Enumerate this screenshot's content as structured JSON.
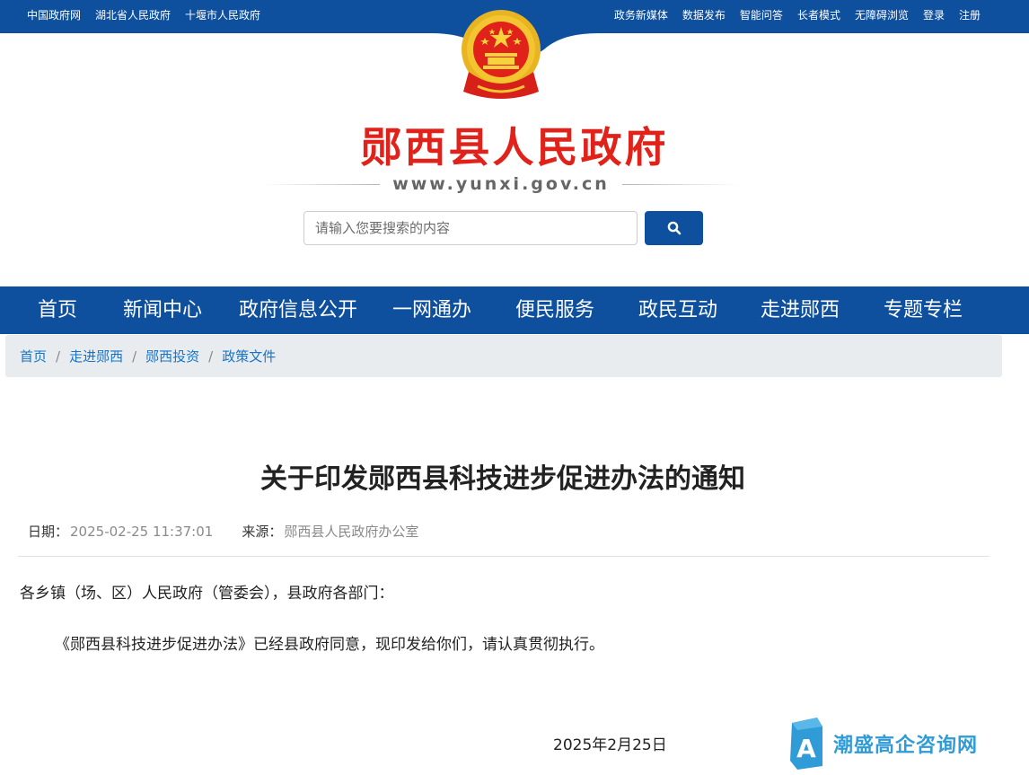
{
  "topbar": {
    "left_links": [
      "中国政府网",
      "湖北省人民政府",
      "十堰市人民政府"
    ],
    "right_links": [
      "政务新媒体",
      "数据发布",
      "智能问答",
      "长者模式",
      "无障碍浏览",
      "登录",
      "注册"
    ]
  },
  "header": {
    "site_title": "郧西县人民政府",
    "domain": "www.yunxi.gov.cn"
  },
  "search": {
    "placeholder": "请输入您要搜索的内容"
  },
  "nav": {
    "items": [
      "首页",
      "新闻中心",
      "政府信息公开",
      "一网通办",
      "便民服务",
      "政民互动",
      "走进郧西",
      "专题专栏"
    ]
  },
  "breadcrumb": {
    "items": [
      "首页",
      "走进郧西",
      "郧西投资",
      "政策文件"
    ],
    "separator": "/"
  },
  "article": {
    "title": "关于印发郧西县科技进步促进办法的通知",
    "date_label": "日期：",
    "date_value": "2025-02-25 11:37:01",
    "source_label": "来源：",
    "source_value": "郧西县人民政府办公室",
    "salutation": "各乡镇（场、区）人民政府（管委会），县政府各部门：",
    "body": "《郧西县科技进步促进办法》已经县政府同意，现印发给你们，请认真贯彻执行。",
    "sign_date": "2025年2月25日"
  },
  "watermark": {
    "text": "潮盛高企咨询网"
  },
  "colors": {
    "brand_blue": "#0e4f9e",
    "title_red": "#e0221a",
    "link_blue": "#1574c9",
    "watermark_blue": "#2f9bd7"
  },
  "icons": {
    "search": "search-icon",
    "emblem": "national-emblem-icon",
    "watermark_logo": "letter-a-logo-icon"
  }
}
